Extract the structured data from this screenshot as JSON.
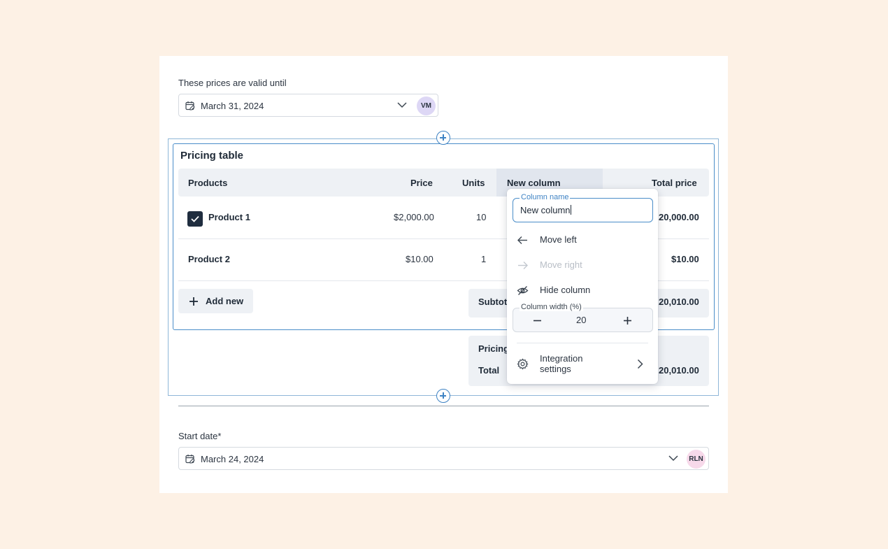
{
  "valid_until": {
    "label": "These prices are valid until",
    "date": "March 31, 2024",
    "avatar": "VM"
  },
  "pricing_table": {
    "title": "Pricing table",
    "headers": [
      "Products",
      "Price",
      "Units",
      "New column",
      "Total price"
    ],
    "rows": [
      {
        "product": "Product 1",
        "price": "$2,000.00",
        "units": "10",
        "total": "20,000.00",
        "checked": true
      },
      {
        "product": "Product 2",
        "price": "$10.00",
        "units": "1",
        "total": "$10.00",
        "checked": false
      }
    ],
    "add_new_label": "Add new",
    "subtotal_label": "Subtot",
    "subtotal_value": "20,010.00",
    "pricing_label": "Pricing",
    "total_label": "Total",
    "total_value": "20,010.00"
  },
  "column_menu": {
    "column_name_legend": "Column name",
    "column_name_value": "New column",
    "move_left": "Move left",
    "move_right": "Move right",
    "hide_column": "Hide column",
    "column_width_legend": "Column width (%)",
    "column_width_value": "20",
    "integration_settings_line1": "Integration",
    "integration_settings_line2": "settings"
  },
  "start_date": {
    "label": "Start date*",
    "date": "March 24, 2024",
    "avatar": "RLN"
  },
  "colors": {
    "page_bg": "#fdf1e5",
    "accent": "#3f83c4",
    "header_bg": "#eef1f5",
    "avatar_vm": "#ddd7f5",
    "avatar_rln": "#f7d9ea"
  }
}
